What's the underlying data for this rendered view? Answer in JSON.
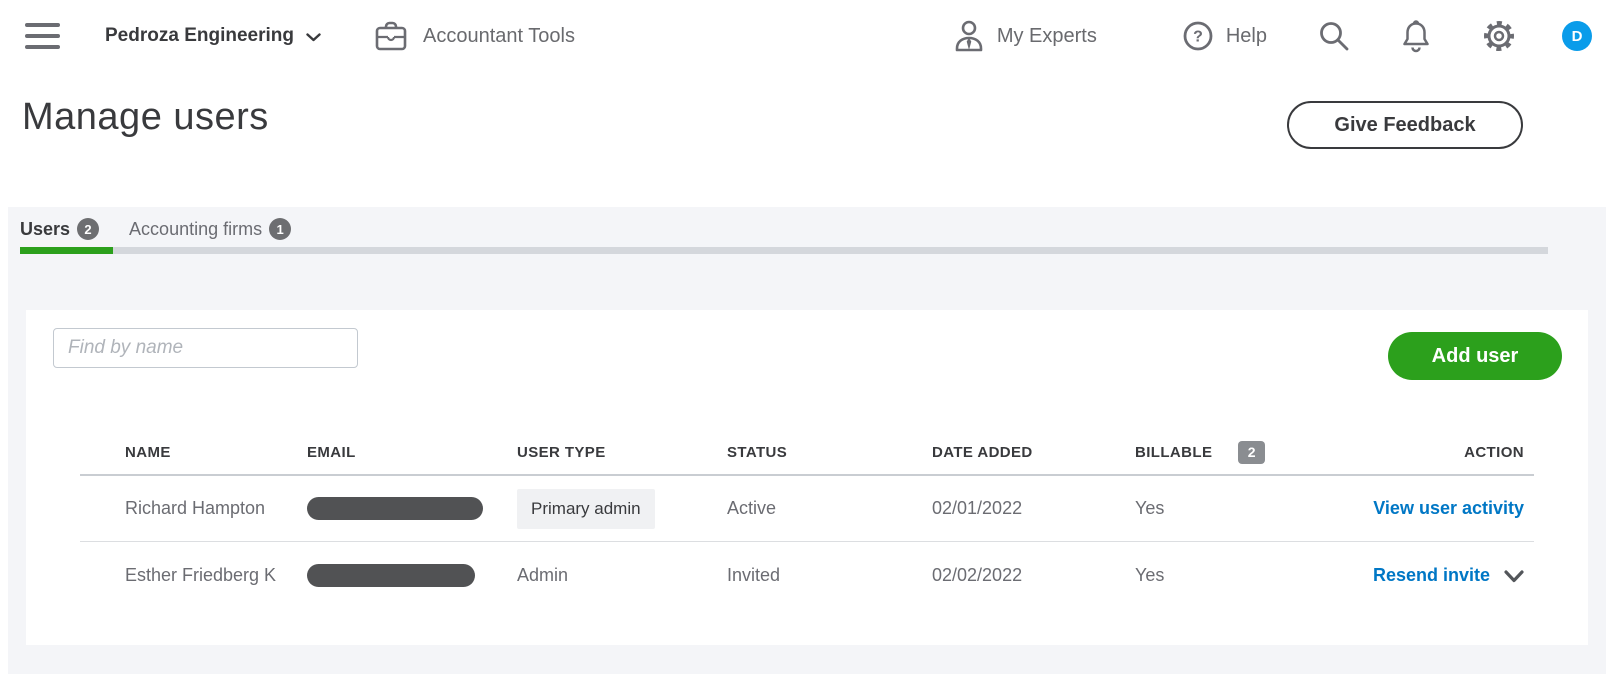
{
  "navbar": {
    "company_name": "Pedroza Engineering",
    "accountant_tools_label": "Accountant Tools",
    "my_experts_label": "My Experts",
    "help_label": "Help",
    "help_glyph": "?",
    "avatar_initial": "D"
  },
  "header": {
    "title": "Manage users",
    "give_feedback_label": "Give Feedback"
  },
  "tabs": {
    "users": {
      "label": "Users",
      "count": "2",
      "active": true
    },
    "accounting_firms": {
      "label": "Accounting firms",
      "count": "1",
      "active": false
    }
  },
  "toolbar": {
    "search_placeholder": "Find by name",
    "add_user_label": "Add user"
  },
  "table": {
    "headers": {
      "name": "NAME",
      "email": "EMAIL",
      "user_type": "USER TYPE",
      "status": "STATUS",
      "date_added": "DATE ADDED",
      "billable": "BILLABLE",
      "action": "ACTION"
    },
    "billable_count_badge": "2",
    "rows": [
      {
        "name": "Richard Hampton",
        "email_redacted": true,
        "user_type": "Primary admin",
        "status": "Active",
        "date_added": "02/01/2022",
        "billable": "Yes",
        "action": "View user activity",
        "action_has_dropdown": false
      },
      {
        "name": "Esther Friedberg K",
        "email_redacted": true,
        "user_type": "Admin",
        "status": "Invited",
        "date_added": "02/02/2022",
        "billable": "Yes",
        "action": "Resend invite",
        "action_has_dropdown": true
      }
    ]
  },
  "colors": {
    "accent_green": "#2ca01c",
    "link_blue": "#0077c5",
    "avatar_blue": "#0a9cea",
    "text_dark": "#393a3d",
    "text_gray": "#6b6c72",
    "panel_gray": "#f4f5f8",
    "track_gray": "#d4d7dc"
  }
}
